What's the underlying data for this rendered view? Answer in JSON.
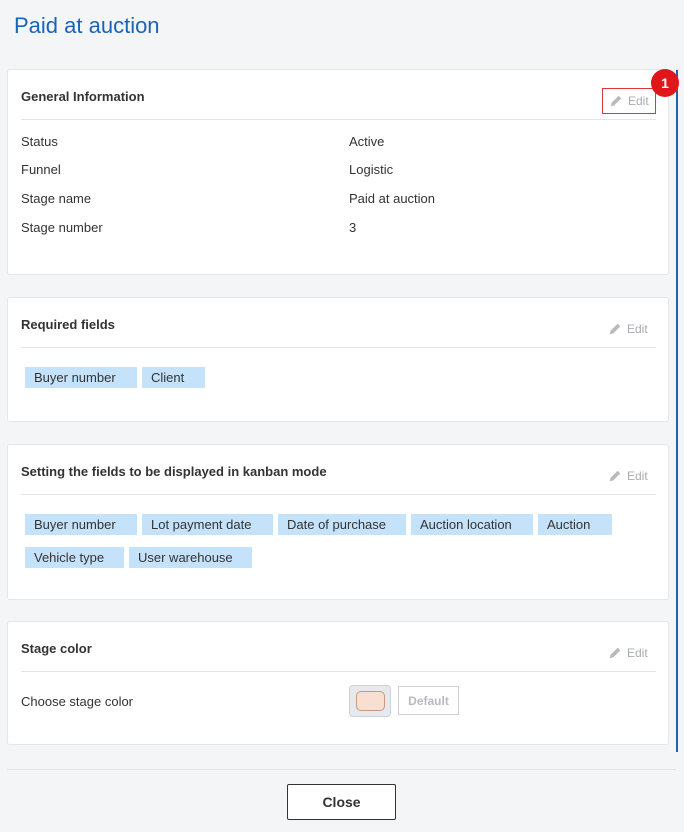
{
  "page": {
    "title": "Paid at auction"
  },
  "general": {
    "title": "General Information",
    "edit_label": "Edit",
    "badge": "1",
    "rows": [
      {
        "label": "Status",
        "value": "Active"
      },
      {
        "label": "Funnel",
        "value": "Logistic"
      },
      {
        "label": "Stage name",
        "value": "Paid at auction"
      },
      {
        "label": "Stage number",
        "value": "3"
      }
    ]
  },
  "required": {
    "title": "Required fields",
    "edit_label": "Edit",
    "chips": [
      "Buyer number",
      "Client"
    ]
  },
  "kanban": {
    "title": "Setting the fields to be displayed in kanban mode",
    "edit_label": "Edit",
    "chips": [
      "Buyer number",
      "Lot payment date",
      "Date of purchase",
      "Auction location",
      "Auction",
      "Vehicle type",
      "User warehouse"
    ]
  },
  "color": {
    "title": "Stage color",
    "edit_label": "Edit",
    "label": "Choose stage color",
    "default_label": "Default",
    "swatch_color": "#f8dfcf"
  },
  "footer": {
    "close_label": "Close"
  },
  "theme": {
    "accent": "#1b64b5",
    "badge": "#e0161b",
    "chip": "#c5e2fb"
  },
  "icons": {
    "edit": "pencil-icon"
  }
}
